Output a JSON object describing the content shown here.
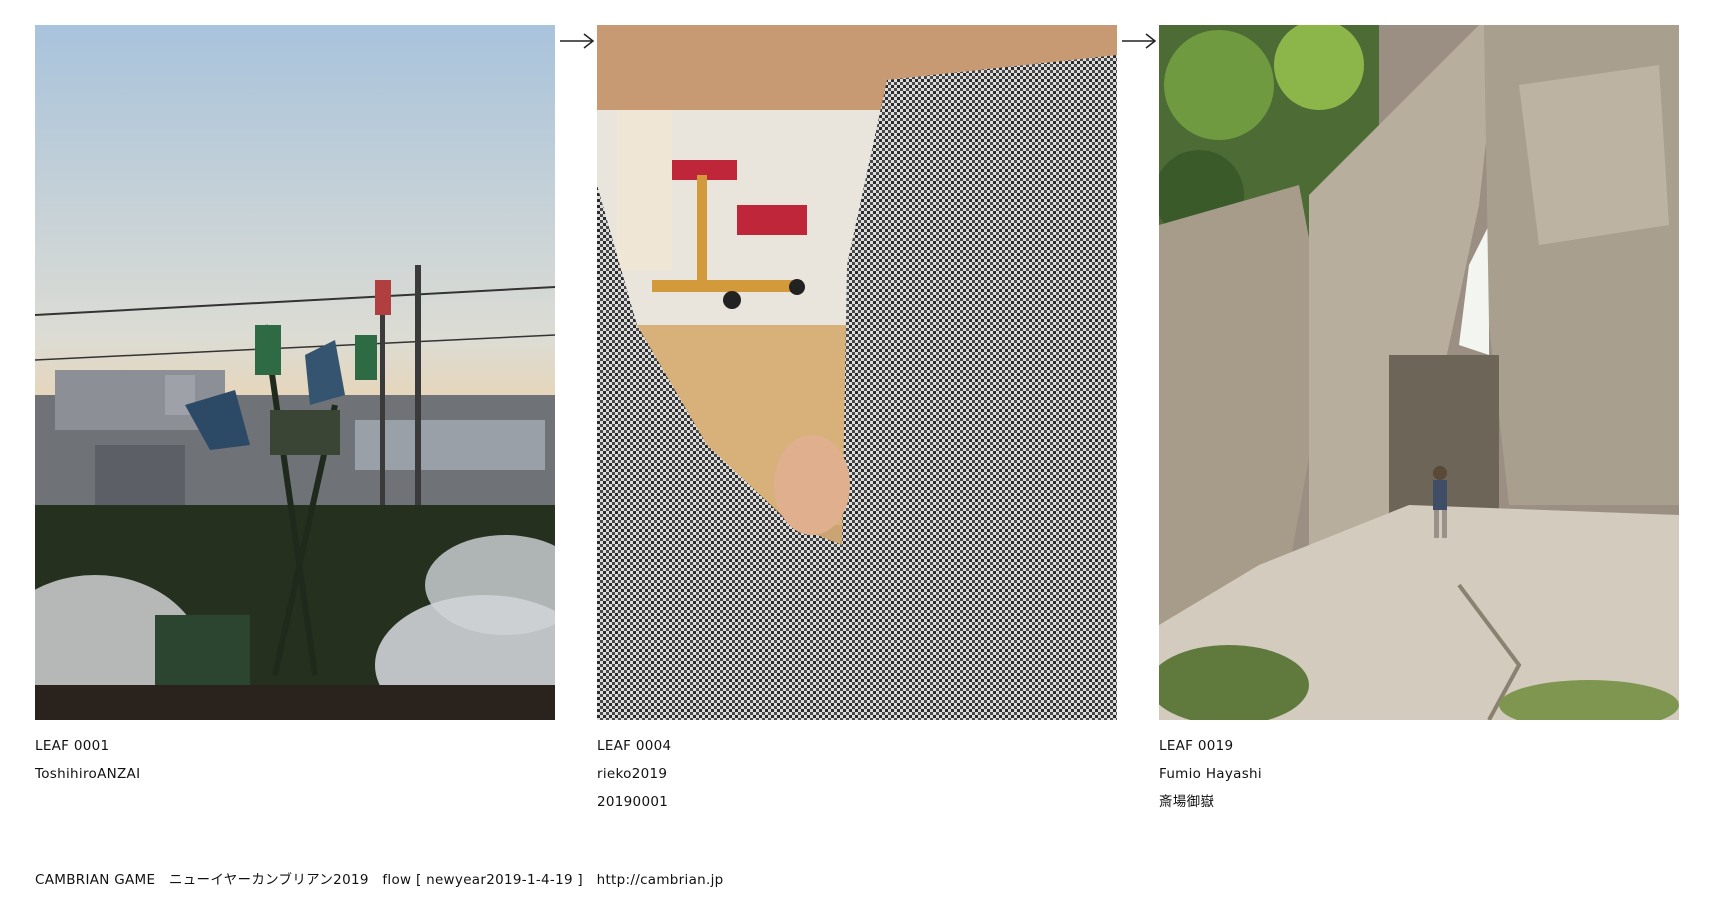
{
  "leaves": [
    {
      "id": "LEAF 0001",
      "author": "ToshihiroANZAI",
      "note": ""
    },
    {
      "id": "LEAF 0004",
      "author": "rieko2019",
      "note": "20190001"
    },
    {
      "id": "LEAF 0019",
      "author": "Fumio Hayashi",
      "note": "斎場御嶽"
    }
  ],
  "footer": {
    "game": "CAMBRIAN GAME",
    "title": "ニューイヤーカンブリアン2019",
    "flow": "flow [ newyear2019-1-4-19 ]",
    "url": "http://cambrian.jp"
  },
  "icons": {
    "flow_arrow": "arrow-right-icon"
  }
}
